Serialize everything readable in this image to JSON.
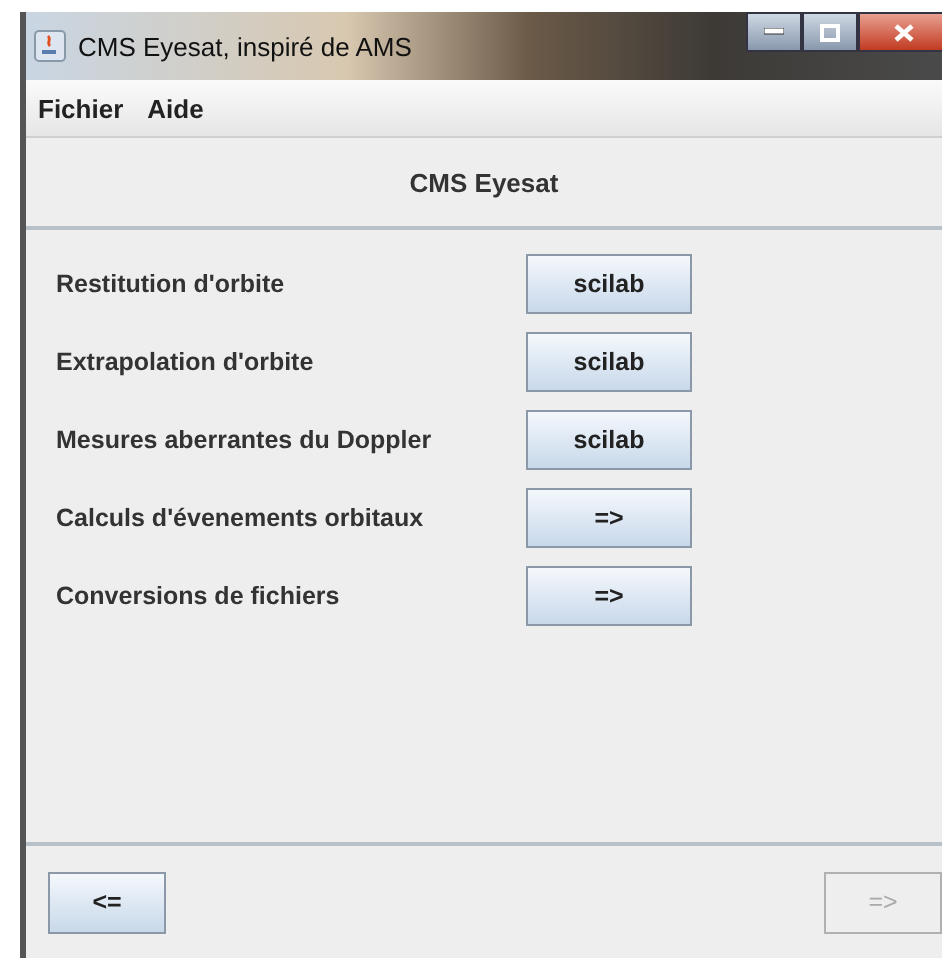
{
  "window": {
    "title": "CMS Eyesat, inspiré de AMS"
  },
  "menu": [
    "Fichier",
    "Aide"
  ],
  "header": "CMS Eyesat",
  "rows": [
    {
      "label": "Restitution d'orbite",
      "button": "scilab"
    },
    {
      "label": "Extrapolation d'orbite",
      "button": "scilab"
    },
    {
      "label": "Mesures aberrantes du Doppler",
      "button": "scilab"
    },
    {
      "label": "Calculs d'évenements orbitaux",
      "button": "=>"
    },
    {
      "label": "Conversions de fichiers",
      "button": "=>"
    }
  ],
  "nav": [
    {
      "label": "<=",
      "disabled": false
    },
    {
      "label": "=>",
      "disabled": true
    }
  ]
}
